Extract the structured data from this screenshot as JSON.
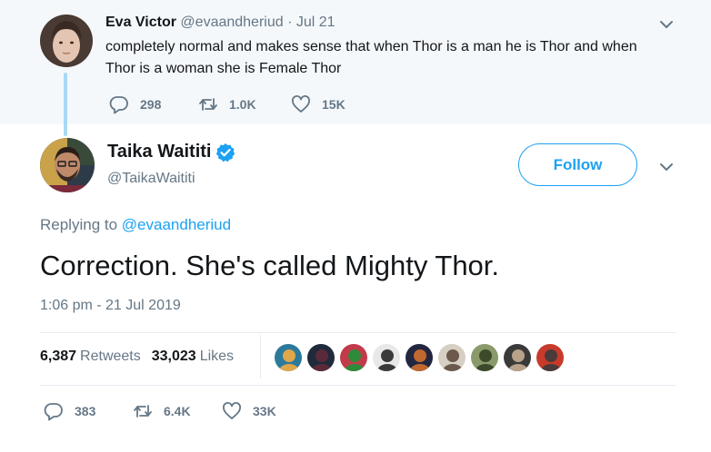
{
  "parent_tweet": {
    "name": "Eva Victor",
    "handle": "@evaandheriud",
    "separator": "·",
    "date": "Jul 21",
    "text": "completely normal and makes sense that when Thor is a man he is Thor and when Thor is a woman she is Female Thor",
    "actions": {
      "replies": "298",
      "retweets": "1.0K",
      "likes": "15K"
    },
    "icons": [
      "reply-icon",
      "retweet-icon",
      "heart-icon",
      "chevron-down-icon"
    ]
  },
  "main_tweet": {
    "name": "Taika Waititi",
    "handle": "@TaikaWaititi",
    "follow_label": "Follow",
    "replying_prefix": "Replying to",
    "replying_handle": "@evaandheriud",
    "text": "Correction. She's called Mighty Thor.",
    "timestamp": "1:06 pm - 21 Jul 2019",
    "retweets_count": "6,387",
    "retweets_label": "Retweets",
    "likes_count": "33,023",
    "likes_label": "Likes",
    "actions": {
      "replies": "383",
      "retweets": "6.4K",
      "likes": "33K"
    },
    "icons": [
      "verified-badge-icon",
      "reply-icon",
      "retweet-icon",
      "heart-icon",
      "chevron-down-icon"
    ]
  },
  "liker_avatars": [
    {
      "name": "liker-avatar-1",
      "colors": [
        "#2b7a9c",
        "#e0a64a"
      ]
    },
    {
      "name": "liker-avatar-2",
      "colors": [
        "#1f2a3a",
        "#5a2a3a"
      ]
    },
    {
      "name": "liker-avatar-3",
      "colors": [
        "#c23b4a",
        "#2f8a3a"
      ]
    },
    {
      "name": "liker-avatar-4",
      "colors": [
        "#e8e8e8",
        "#3a3a3a"
      ]
    },
    {
      "name": "liker-avatar-5",
      "colors": [
        "#23263f",
        "#c0692f"
      ]
    },
    {
      "name": "liker-avatar-6",
      "colors": [
        "#d8cfc4",
        "#6b5a4c"
      ]
    },
    {
      "name": "liker-avatar-7",
      "colors": [
        "#8a9a6a",
        "#3a4a2a"
      ]
    },
    {
      "name": "liker-avatar-8",
      "colors": [
        "#3a3a3a",
        "#b8a38a"
      ]
    },
    {
      "name": "liker-avatar-9",
      "colors": [
        "#c83a2a",
        "#4a3a3a"
      ]
    }
  ],
  "colors": {
    "accent": "#1da1f2",
    "muted": "#657786",
    "text": "#14171a",
    "parent_bg": "#f5f8fa",
    "thread_line": "#a9d9f5"
  }
}
